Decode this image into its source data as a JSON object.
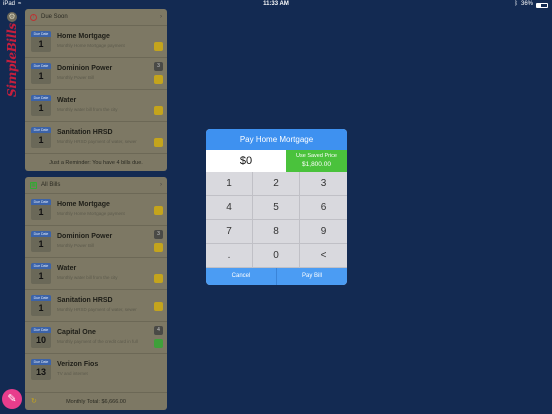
{
  "status": {
    "device": "iPad",
    "time": "11:33 AM",
    "battery": "36%"
  },
  "app": {
    "logo_text": "SimpleBills"
  },
  "due_soon": {
    "title": "Due Soon",
    "bills": [
      {
        "date_label": "Due Date",
        "day": "1",
        "name": "Home Mortgage",
        "desc": "Monthly Home Mortgage payment"
      },
      {
        "date_label": "Due Date",
        "day": "1",
        "name": "Dominion Power",
        "desc": "Monthly Power Bill",
        "count": "3"
      },
      {
        "date_label": "Due Date",
        "day": "1",
        "name": "Water",
        "desc": "Monthly water bill from the city"
      },
      {
        "date_label": "Due Date",
        "day": "1",
        "name": "Sanitation HRSD",
        "desc": "Monthly HRSD payment of water, sewer"
      }
    ],
    "footer": "Just a Reminder: You have 4 bills due."
  },
  "all_bills": {
    "title": "All Bills",
    "bills": [
      {
        "date_label": "Due Date",
        "day": "1",
        "name": "Home Mortgage",
        "desc": "Monthly Home Mortgage payment"
      },
      {
        "date_label": "Due Date",
        "day": "1",
        "name": "Dominion Power",
        "desc": "Monthly Power Bill",
        "count": "3"
      },
      {
        "date_label": "Due Date",
        "day": "1",
        "name": "Water",
        "desc": "Monthly water bill from the city"
      },
      {
        "date_label": "Due Date",
        "day": "1",
        "name": "Sanitation HRSD",
        "desc": "Monthly HRSD payment of water, sewer"
      },
      {
        "date_label": "Due Date",
        "day": "10",
        "name": "Capital One",
        "desc": "Monthly payment of the credit card in full",
        "count": "4"
      },
      {
        "date_label": "Due Date",
        "day": "13",
        "name": "Verizon Fios",
        "desc": "TV and internet"
      }
    ],
    "footer": "Monthly Total: $6,666.00"
  },
  "dialog": {
    "title": "Pay Home Mortgage",
    "amount": "$0",
    "saved_label": "Use Saved Price",
    "saved_value": "$1,800.00",
    "keys": [
      "1",
      "2",
      "3",
      "4",
      "5",
      "6",
      "7",
      "8",
      "9",
      ".",
      "0",
      "<"
    ],
    "cancel": "Cancel",
    "pay": "Pay Bill"
  },
  "colors": {
    "background": "#132a52",
    "accent_blue": "#3e91f0",
    "saved_green": "#4ac23c",
    "fab_pink": "#e83d8c"
  }
}
